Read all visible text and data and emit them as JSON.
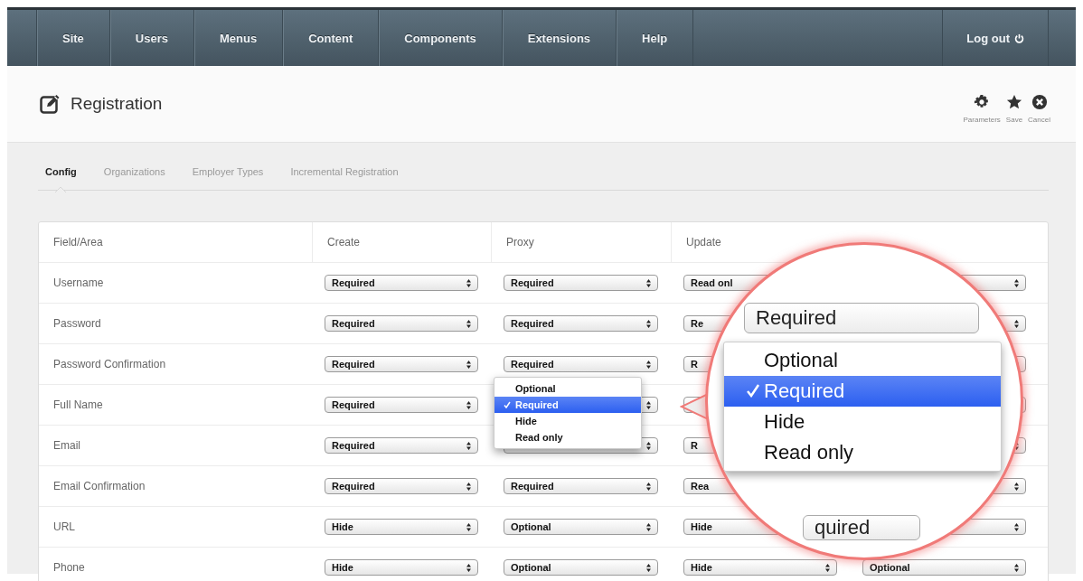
{
  "nav": {
    "items": [
      "Site",
      "Users",
      "Menus",
      "Content",
      "Components",
      "Extensions",
      "Help"
    ],
    "logout": "Log out"
  },
  "header": {
    "title": "Registration",
    "actions": [
      {
        "label": "Parameters",
        "kind": "gear"
      },
      {
        "label": "Save",
        "kind": "star"
      },
      {
        "label": "Cancel",
        "kind": "cancel"
      }
    ]
  },
  "tabs": [
    {
      "label": "Config",
      "selected": true
    },
    {
      "label": "Organizations",
      "selected": false
    },
    {
      "label": "Employer Types",
      "selected": false
    },
    {
      "label": "Incremental Registration",
      "selected": false
    }
  ],
  "table": {
    "columns": [
      "Field/Area",
      "Create",
      "Proxy",
      "Update"
    ],
    "rows": [
      {
        "field": "Username",
        "create": "Required",
        "proxy": "Required",
        "update": "Read onl"
      },
      {
        "field": "Password",
        "create": "Required",
        "proxy": "Required",
        "update": "Re"
      },
      {
        "field": "Password Confirmation",
        "create": "Required",
        "proxy": "Required",
        "update": "R"
      },
      {
        "field": "Full Name",
        "create": "Required",
        "proxy_menu": [
          {
            "label": "Optional",
            "selected": false
          },
          {
            "label": "Required",
            "selected": true
          },
          {
            "label": "Hide",
            "selected": false
          },
          {
            "label": "Read only",
            "selected": false
          }
        ]
      },
      {
        "field": "Email",
        "create": "Required",
        "update": "R"
      },
      {
        "field": "Email Confirmation",
        "create": "Required",
        "proxy": "Required",
        "update": "Rea"
      },
      {
        "field": "URL",
        "create": "Hide",
        "proxy": "Optional",
        "update": "Hide"
      },
      {
        "field": "Phone",
        "create": "Hide",
        "proxy": "Optional",
        "update": "Hide",
        "column_5": "Optional"
      }
    ]
  },
  "magnifier": {
    "value": "Required",
    "options": [
      {
        "label": "Optional",
        "selected": false
      },
      {
        "label": "Required",
        "selected": true
      },
      {
        "label": "Hide",
        "selected": false
      },
      {
        "label": "Read only",
        "selected": false
      }
    ],
    "below_value": "quired"
  }
}
